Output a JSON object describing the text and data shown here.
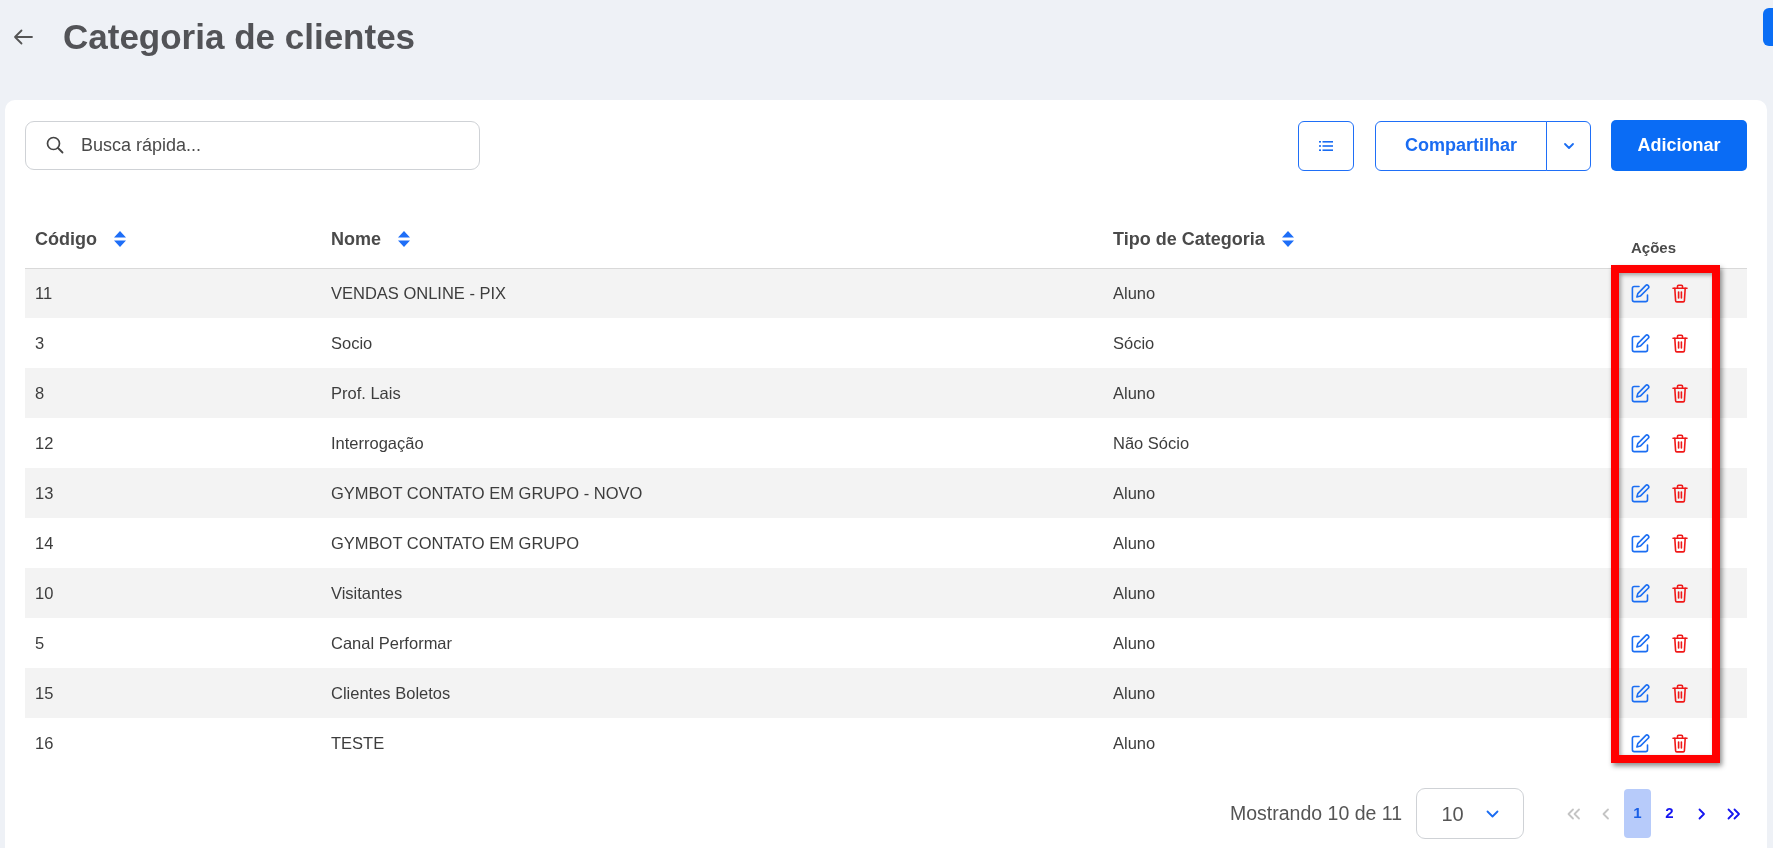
{
  "header": {
    "title": "Categoria de clientes"
  },
  "toolbar": {
    "search": {
      "placeholder": "Busca rápida..."
    },
    "buttons": [
      {
        "kind": "list"
      },
      {
        "kind": "split",
        "label": "Compartilhar"
      },
      {
        "kind": "primary",
        "label": "Adicionar"
      }
    ]
  },
  "table": {
    "columns": [
      {
        "label": "Código",
        "sortable": true
      },
      {
        "label": "Nome",
        "sortable": true
      },
      {
        "label": "Tipo de Categoria",
        "sortable": true
      },
      {
        "label": "Ações",
        "sortable": false
      }
    ],
    "rows": [
      {
        "cells": [
          "11",
          "VENDAS ONLINE - PIX",
          "Aluno"
        ]
      },
      {
        "cells": [
          "3",
          "Socio",
          "Sócio"
        ]
      },
      {
        "cells": [
          "8",
          "Prof. Lais",
          "Aluno"
        ]
      },
      {
        "cells": [
          "12",
          "Interrogação",
          "Não Sócio"
        ]
      },
      {
        "cells": [
          "13",
          "GYMBOT CONTATO EM GRUPO - NOVO",
          "Aluno"
        ]
      },
      {
        "cells": [
          "14",
          "GYMBOT CONTATO EM GRUPO",
          "Aluno"
        ]
      },
      {
        "cells": [
          "10",
          "Visitantes",
          "Aluno"
        ]
      },
      {
        "cells": [
          "5",
          "Canal Performar",
          "Aluno"
        ]
      },
      {
        "cells": [
          "15",
          "Clientes Boletos",
          "Aluno"
        ]
      },
      {
        "cells": [
          "16",
          "TESTE",
          "Aluno"
        ]
      }
    ],
    "actions_highlighted": true
  },
  "pagination": {
    "summary": "Mostrando 10 de 11",
    "page_size": "10",
    "items": [
      {
        "kind": "first",
        "disabled": true
      },
      {
        "kind": "prev",
        "disabled": true
      },
      {
        "kind": "page",
        "label": "1",
        "selected": true
      },
      {
        "kind": "page",
        "label": "2",
        "selected": false
      },
      {
        "kind": "next",
        "disabled": false
      },
      {
        "kind": "last",
        "disabled": false
      }
    ]
  }
}
